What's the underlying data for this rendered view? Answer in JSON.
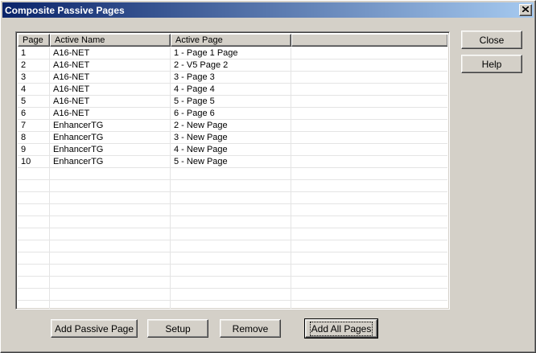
{
  "window": {
    "title": "Composite Passive Pages"
  },
  "table": {
    "columns": [
      "Page",
      "Active Name",
      "Active Page",
      ""
    ],
    "rows": [
      [
        "1",
        "A16-NET",
        "1 - Page 1 Page"
      ],
      [
        "2",
        "A16-NET",
        "2 - V5 Page 2"
      ],
      [
        "3",
        "A16-NET",
        "3 - Page 3"
      ],
      [
        "4",
        "A16-NET",
        "4 - Page 4"
      ],
      [
        "5",
        "A16-NET",
        "5 - Page 5"
      ],
      [
        "6",
        "A16-NET",
        "6 - Page 6"
      ],
      [
        "7",
        "EnhancerTG",
        "2 - New Page"
      ],
      [
        "8",
        "EnhancerTG",
        "3 - New Page"
      ],
      [
        "9",
        "EnhancerTG",
        "4 - New Page"
      ],
      [
        "10",
        "EnhancerTG",
        "5 - New Page"
      ]
    ]
  },
  "side_buttons": {
    "close": "Close",
    "help": "Help"
  },
  "bottom_buttons": {
    "add_passive": "Add Passive Page",
    "setup": "Setup",
    "remove": "Remove",
    "add_all": "Add All Pages"
  },
  "colors": {
    "titlebar_start": "#0a246a",
    "titlebar_end": "#a6caf0",
    "face": "#d4d0c8"
  }
}
